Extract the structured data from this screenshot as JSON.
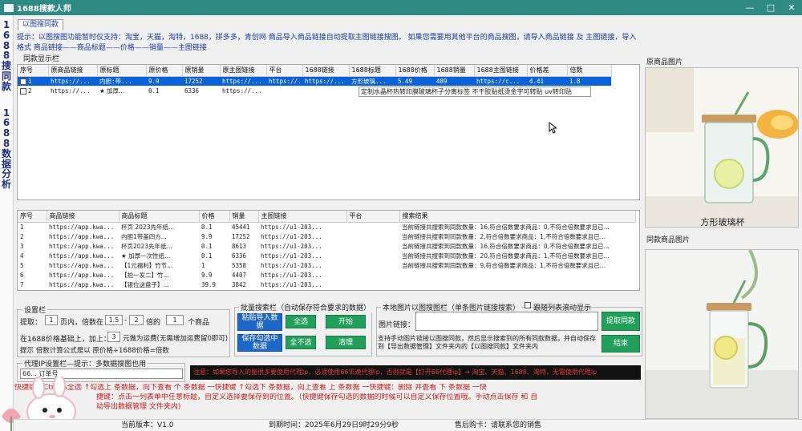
{
  "window": {
    "title": "1688搜款人师",
    "minimize": "—",
    "maximize": "□",
    "close": "✕"
  },
  "sidebar": {
    "tab1": [
      "1",
      "6",
      "8",
      "8",
      "搜",
      "同",
      "款"
    ],
    "tab2": [
      "1",
      "6",
      "8",
      "8",
      "数",
      "据",
      "分",
      "析"
    ]
  },
  "tab_label": "以图搜同款",
  "hint_text": "提示：以图搜图功能暂时仅支持：淘宝，天猫，淘特，1688，拼多多，青创网  商品导入商品链接自动提取主图链接搜图。  如果您需要用其他平台的商品搜图，请导入商品链接 及 主图链接，导入格式 商品链接——商品标题——价格——销量——主图链接",
  "top_group": {
    "title": "同款显示栏",
    "columns": [
      "序号",
      "原商品链接",
      "原标题",
      "原价格",
      "原销量",
      "原主图链接",
      "平台",
      "1688链接",
      "1688标题",
      "1688价格",
      "1688销量",
      "1688主图链接",
      "价格差",
      "倍数"
    ],
    "rows": [
      [
        "1",
        "https://...",
        "内胆:带...",
        "9.9",
        "17252",
        "https://...",
        "https://...",
        "https://...",
        "方形玻璃...",
        "5.49",
        "489",
        "https://c...",
        "4.41",
        "1.8"
      ],
      [
        "2",
        "https://...",
        "★ 加厚...",
        "0.1",
        "6336",
        "https://...",
        "",
        "",
        "",
        "",
        "",
        "",
        "",
        ""
      ]
    ],
    "tooltip": "定制水晶杯热转印膜玻璃杯子分离标签 不干胶贴纸烫金字可转贴 uv转印贴"
  },
  "bottom_group": {
    "columns": [
      "序号",
      "商品链接",
      "商品标题",
      "价格",
      "销量",
      "主图链接",
      "平台",
      "搜索结果"
    ],
    "rows": [
      [
        "1",
        "https://app.kwa...",
        "杯页 2023先年纸...",
        "0.1",
        "45441",
        "https://u1-203...",
        "",
        "当前链接共搜索到同款数量：16,符合倍数要求商品：0,不符合倍数要求且已..."
      ],
      [
        "2",
        "https://app.kwa...",
        "内胆1带盖四方...",
        "9.9",
        "17252",
        "https://u1-203...",
        "",
        "当前链接共搜索到同款数量：2,符合倍数要求商品：1,不符合倍数要求且已..."
      ],
      [
        "3",
        "https://app.kwa...",
        "杯页2023先年纸...",
        "0.1",
        "8613",
        "https://u1-203...",
        "",
        "当前链接共搜索到同款数量：16,符合倍数要求商品：0,不符合倍数要求且已..."
      ],
      [
        "4",
        "https://app.kwa...",
        "★ 加厚一次性纸...",
        "0.1",
        "6336",
        "https://u1-203...",
        "",
        "当前链接共搜索到同款数量：20,符合倍数要求商品：1,不符合倍数要求且已..."
      ],
      [
        "5",
        "https://app.kwa...",
        "【1元福利】竹节...",
        "1",
        "5358",
        "https://u1-203...",
        "",
        "当前链接共搜索到同款数量：9,符合倍数要求商品：1,不符合倍数要求且已..."
      ],
      [
        "6",
        "https://app.kwa...",
        "【拍一发二】竹...",
        "9.9",
        "4407",
        "https://u1-203...",
        "",
        ""
      ],
      [
        "7",
        "https://app.kwa...",
        "【银位送盘子】...",
        "39.9",
        "3842",
        "https://u1-203...",
        "",
        ""
      ]
    ]
  },
  "images": {
    "original_title": "原商品图片",
    "original_caption": "方形玻璃杯",
    "same_title": "同款商品图片"
  },
  "settings": {
    "title": "设置栏",
    "extract_label": "提取：",
    "extract_value": "1",
    "pages_label": "页内，倍数在",
    "ratio_min": "1.5",
    "ratio_sep": "-",
    "ratio_max": "2",
    "ratio_unit": "倍的",
    "count_value": "1",
    "count_unit": "个商品",
    "base_label": "在1688价格基础上，加上：",
    "add_value": "3",
    "add_unit": "元做为运费(无需增加运费留0即可)",
    "formula": "提示  倍数计算公式是以  原价格÷1688价格=倍数"
  },
  "proxy": {
    "title": "代理IP设置栏—提示：多数据搜图也用",
    "value": "66...                      订单号"
  },
  "batch": {
    "title": "批量搜索栏（自动保存符合要求的数据）",
    "paste_button": "粘贴导入数据",
    "select_all": "全选",
    "start": "开始",
    "save_checked": "保存勾选中数据",
    "select_none": "全不选",
    "clear": "清理"
  },
  "local": {
    "title": "本地图片以图搜图栏（单条图片链接搜索）",
    "follow_scroll": "跟随列表滚动显示",
    "link_label": "图片链接：",
    "extract_button": "提取同款",
    "end_button": "结束",
    "note": "支持手动图片链接以图搜同款，然后显示搜索到的所有同款数据，并自动保存到【导出数据管理】文件夹内的【以图搜同款】文件夹内"
  },
  "dark_notice": "注意：如果您导入的量很多要使用代理ip，必须使用66讯速代理ip，否则就是【打开66代理ip】→ 淘宝、天猫、1688、淘特，无需使用代理ip",
  "red_notes": {
    "line1": "快捷键：Ctrl+A全选 ↑勾选上 条数据，向下查看 个 条数据 一快捷键 ↑勾选下 条数据，向上查看 上 条数据 一快捷键：删除 并查看 下 条数据 一快",
    "line2": "捷键：点击一列表单中任意标题，自定义选择要保存到的位置。（快捷键保存勾选的数据的时候可以自定义保存位置哦。手动点击保存 和 自",
    "line3": "动导出数据管理 文件夹内)"
  },
  "status": {
    "version": "当前版本：V1.0",
    "expiry": "到期时间：2025年6月29日9时29分9秒",
    "contact": "售后购卡：请联系您的销售"
  }
}
